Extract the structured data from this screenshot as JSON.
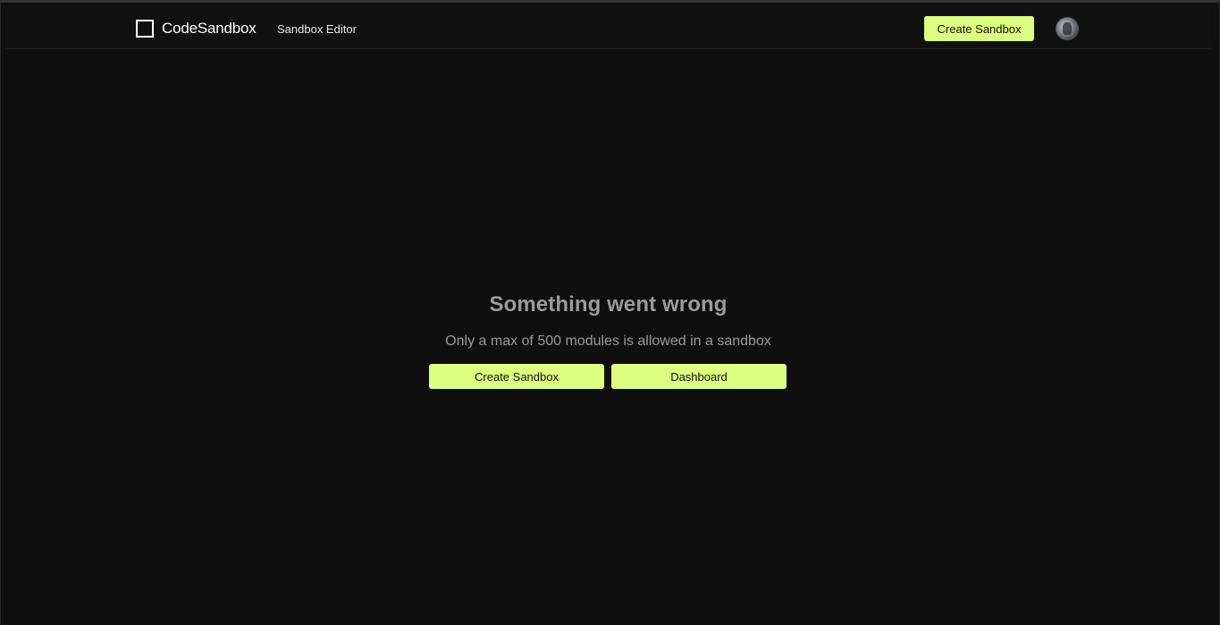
{
  "header": {
    "brand": "CodeSandbox",
    "section_label": "Sandbox Editor",
    "create_button_label": "Create Sandbox"
  },
  "error": {
    "title": "Something went wrong",
    "message": "Only a max of 500 modules is allowed in a sandbox",
    "create_button_label": "Create Sandbox",
    "dashboard_button_label": "Dashboard"
  },
  "colors": {
    "background": "#0f0f0f",
    "accent": "#dcff7f",
    "muted_text": "#9b9b9b"
  },
  "icons": {
    "logo": "codesandbox-logo-icon",
    "avatar": "user-avatar"
  }
}
